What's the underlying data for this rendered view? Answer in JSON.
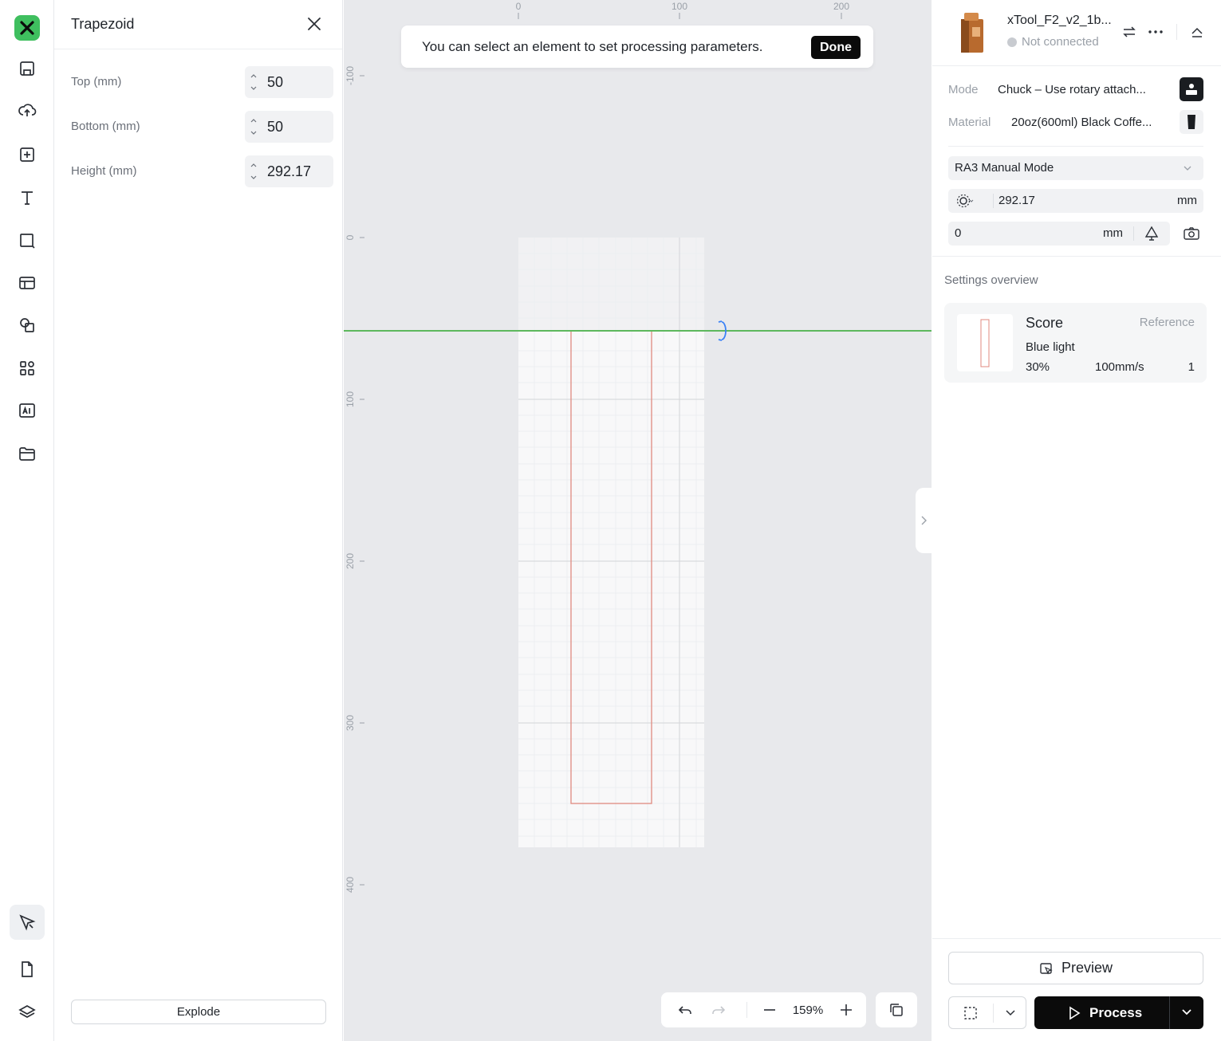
{
  "toolbar": {
    "items": [
      "logo-icon",
      "save-icon",
      "upload-icon",
      "add-icon",
      "text-icon",
      "shape-icon",
      "layout-icon",
      "combine-icon",
      "elements-icon",
      "ai-icon",
      "folder-icon"
    ],
    "bottom_items": [
      "select-icon",
      "document-icon",
      "layers-icon"
    ]
  },
  "props": {
    "title": "Trapezoid",
    "fields": [
      {
        "label": "Top (mm)",
        "value": "50"
      },
      {
        "label": "Bottom (mm)",
        "value": "50"
      },
      {
        "label": "Height (mm)",
        "value": "292.17"
      }
    ],
    "explode_label": "Explode"
  },
  "canvas": {
    "toast_text": "You can select an element to set processing parameters.",
    "toast_button": "Done",
    "ruler_top": [
      "0",
      "100",
      "200"
    ],
    "ruler_left": [
      "-100",
      "0",
      "100",
      "200",
      "300",
      "400"
    ],
    "zoom": "159%"
  },
  "device": {
    "name": "xTool_F2_v2_1b...",
    "status": "Not connected",
    "mode_label": "Mode",
    "mode_value": "Chuck – Use rotary attach...",
    "material_label": "Material",
    "material_value": "20oz(600ml) Black Coffe...",
    "rotary_mode": "RA3 Manual Mode",
    "diameter_value": "292.17",
    "diameter_unit": "mm",
    "offset_value": "0",
    "offset_unit": "mm"
  },
  "settings": {
    "title": "Settings overview",
    "card": {
      "process": "Score",
      "tag": "Reference",
      "light": "Blue light",
      "power": "30%",
      "speed": "100mm/s",
      "passes": "1"
    }
  },
  "footer": {
    "preview_label": "Preview",
    "process_label": "Process"
  },
  "colors": {
    "brand": "#3fbf5f",
    "guide_line": "#5db85d",
    "shape_outline": "#e08a7f",
    "rotary_handle": "#3b82f6"
  }
}
